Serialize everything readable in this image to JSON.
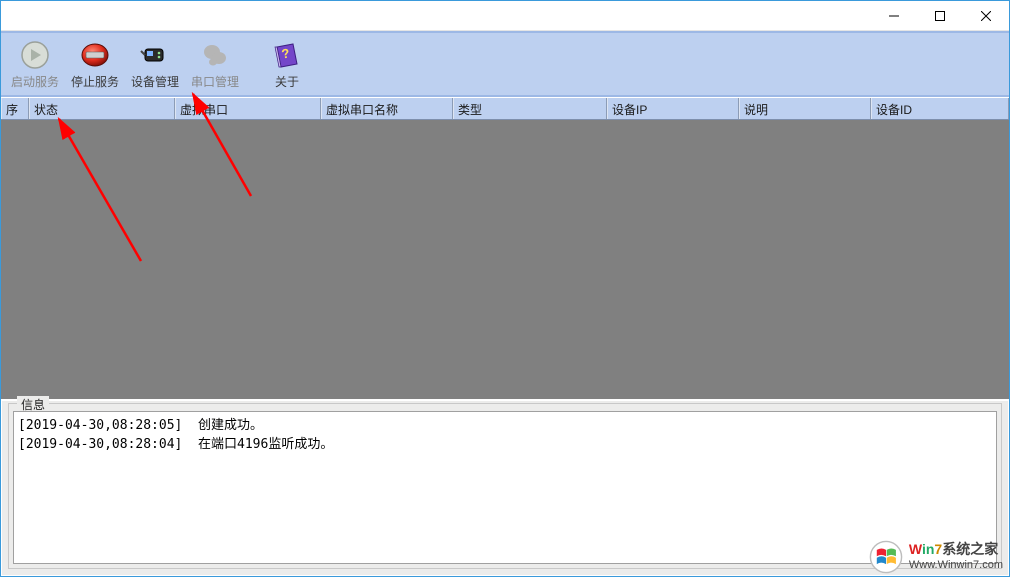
{
  "toolbar": {
    "start_service": "启动服务",
    "stop_service": "停止服务",
    "device_mgmt": "设备管理",
    "serial_mgmt": "串口管理",
    "about": "关于"
  },
  "table": {
    "columns": {
      "seq": "序",
      "status": "状态",
      "vport": "虚拟串口",
      "vname": "虚拟串口名称",
      "type": "类型",
      "ip": "设备IP",
      "desc": "说明",
      "devid": "设备ID"
    },
    "rows": []
  },
  "info": {
    "legend": "信息",
    "logs": [
      "[2019-04-30,08:28:05]  创建成功。",
      "[2019-04-30,08:28:04]  在端口4196监听成功。"
    ]
  },
  "watermark": {
    "line1_parts": {
      "w": "W",
      "in": "in",
      "n7": "7",
      "rest": "系统之家"
    },
    "line2": "Www.Winwin7.com"
  }
}
